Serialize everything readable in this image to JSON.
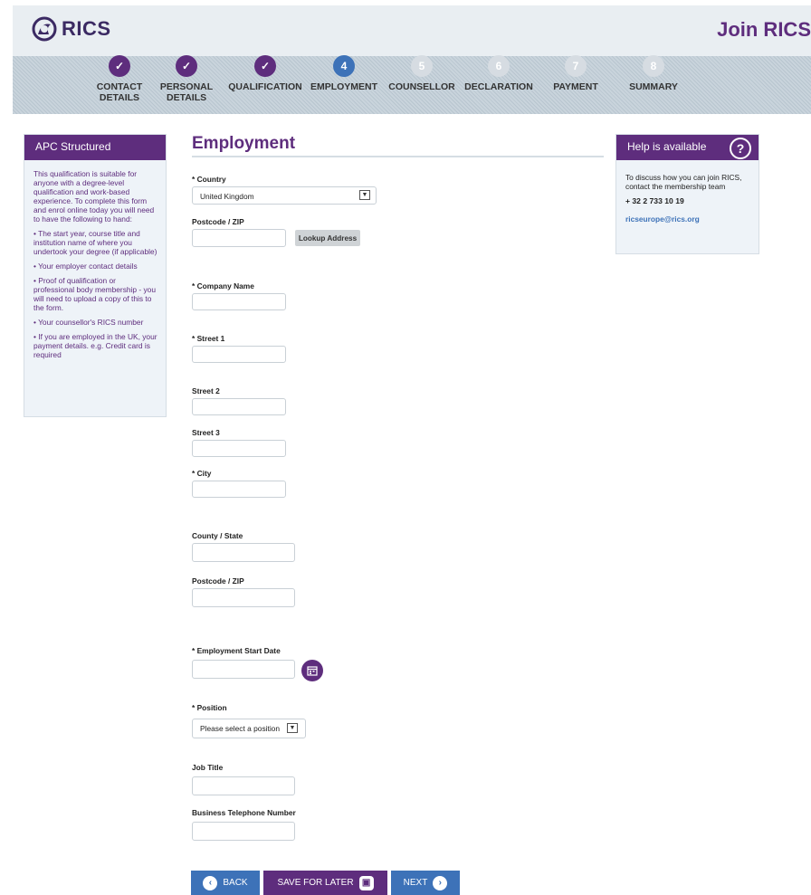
{
  "brand": {
    "logo_text": "RICS",
    "page_title": "Join RICS"
  },
  "colors": {
    "purple": "#5e2d7d",
    "blue": "#3d72b8",
    "grey": "#d6dce2"
  },
  "steps": [
    {
      "number": "1",
      "line1": "CONTACT",
      "line2": "DETAILS",
      "status": "done"
    },
    {
      "number": "2",
      "line1": "PERSONAL",
      "line2": "DETAILS",
      "status": "done"
    },
    {
      "number": "3",
      "line1": "QUALIFICATION",
      "line2": "",
      "status": "done"
    },
    {
      "number": "4",
      "line1": "EMPLOYMENT",
      "line2": "",
      "status": "current"
    },
    {
      "number": "5",
      "line1": "COUNSELLOR",
      "line2": "",
      "status": "todo"
    },
    {
      "number": "6",
      "line1": "DECLARATION",
      "line2": "",
      "status": "todo"
    },
    {
      "number": "7",
      "line1": "PAYMENT",
      "line2": "",
      "status": "todo"
    },
    {
      "number": "8",
      "line1": "SUMMARY",
      "line2": "",
      "status": "todo"
    }
  ],
  "sidebar": {
    "title": "APC Structured",
    "intro": "This qualification is suitable for anyone with a degree-level qualification and work-based experience. To complete this form and enrol online today you will need to have the following to hand:",
    "items": [
      "• The start year, course title and institution name of where you undertook your degree (if applicable)",
      "• Your employer contact details",
      "• Proof of qualification or professional body membership - you will need to upload a copy of this to the form.",
      "• Your counsellor's RICS number",
      "• If you are employed in the UK, your payment details. e.g. Credit card is required"
    ]
  },
  "form": {
    "title": "Employment",
    "country_label": "* Country",
    "country_value": "United Kingdom",
    "postcode1_label": "Postcode / ZIP",
    "lookup_button": "Lookup Address",
    "company_label": "* Company Name",
    "street1_label": "* Street 1",
    "street2_label": "Street 2",
    "street3_label": "Street 3",
    "city_label": "* City",
    "county_label": "County / State",
    "postcode2_label": "Postcode / ZIP",
    "start_date_label": "* Employment Start Date",
    "position_label": "* Position",
    "position_value": "Please select a position",
    "job_title_label": "Job Title",
    "phone_label": "Business Telephone Number"
  },
  "help": {
    "title": "Help is available",
    "text": "To discuss how you can join RICS, contact the membership team",
    "phone": "+ 32 2 733 10 19",
    "email": "ricseurope@rics.org"
  },
  "buttons": {
    "back": "BACK",
    "save": "SAVE FOR LATER",
    "next": "NEXT"
  }
}
